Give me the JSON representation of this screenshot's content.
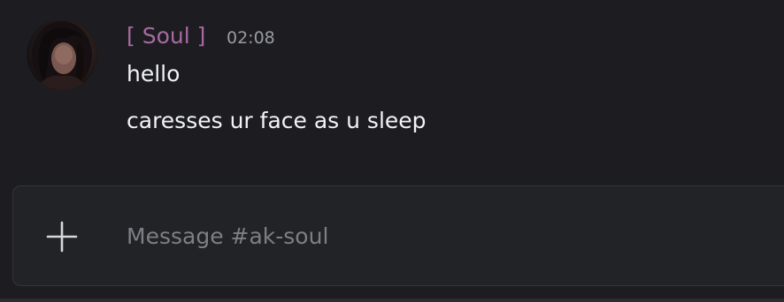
{
  "message": {
    "author": "[ Soul ]",
    "timestamp": "02:08",
    "lines": [
      "hello",
      "caresses ur face as u sleep"
    ]
  },
  "composer": {
    "placeholder": "Message #ak-soul",
    "add_icon": "plus-icon"
  },
  "colors": {
    "background": "#1c1c21",
    "author": "#a86aa0",
    "text": "#f2f3f5",
    "muted": "#9a9aa3",
    "composer_bg": "#222327"
  }
}
